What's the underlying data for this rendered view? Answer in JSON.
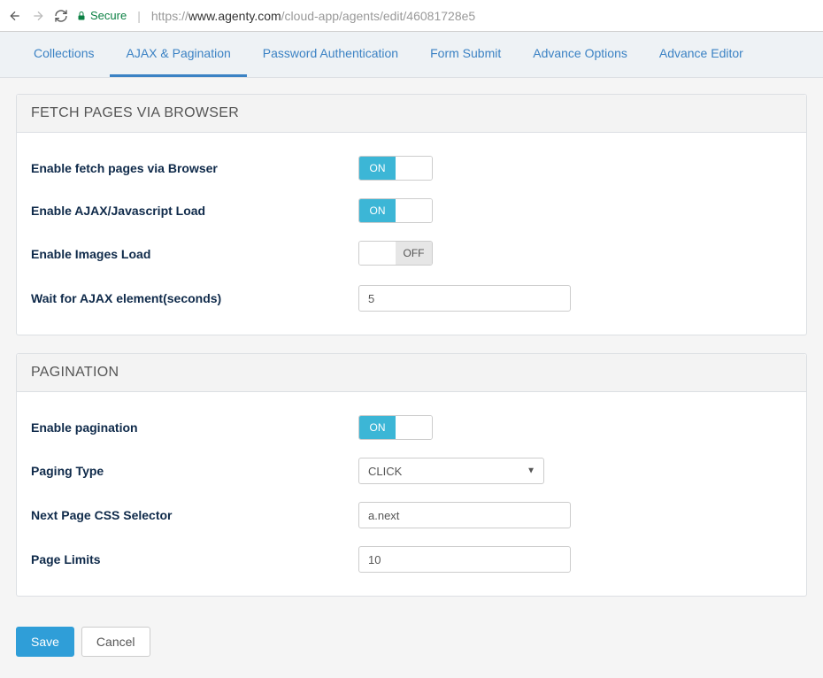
{
  "browser": {
    "secure_label": "Secure",
    "url_prefix": "https://",
    "url_host": "www.agenty.com",
    "url_path": "/cloud-app/agents/edit/46081728e5"
  },
  "tabs": [
    {
      "label": "Collections"
    },
    {
      "label": "AJAX & Pagination",
      "active": true
    },
    {
      "label": "Password Authentication"
    },
    {
      "label": "Form Submit"
    },
    {
      "label": "Advance Options"
    },
    {
      "label": "Advance Editor"
    }
  ],
  "panel_fetch": {
    "title": "FETCH PAGES VIA BROWSER",
    "rows": {
      "enable_browser": {
        "label": "Enable fetch pages via Browser",
        "state": "ON"
      },
      "enable_ajax": {
        "label": "Enable AJAX/Javascript Load",
        "state": "ON"
      },
      "enable_images": {
        "label": "Enable Images Load",
        "state": "OFF"
      },
      "wait_ajax": {
        "label": "Wait for AJAX element(seconds)",
        "value": "5"
      }
    }
  },
  "panel_pagination": {
    "title": "PAGINATION",
    "rows": {
      "enable_pagination": {
        "label": "Enable pagination",
        "state": "ON"
      },
      "paging_type": {
        "label": "Paging Type",
        "value": "CLICK"
      },
      "next_css": {
        "label": "Next Page CSS Selector",
        "value": "a.next"
      },
      "page_limits": {
        "label": "Page Limits",
        "value": "10"
      }
    }
  },
  "buttons": {
    "save": "Save",
    "cancel": "Cancel"
  },
  "toggle_labels": {
    "on": "ON",
    "off": "OFF"
  }
}
